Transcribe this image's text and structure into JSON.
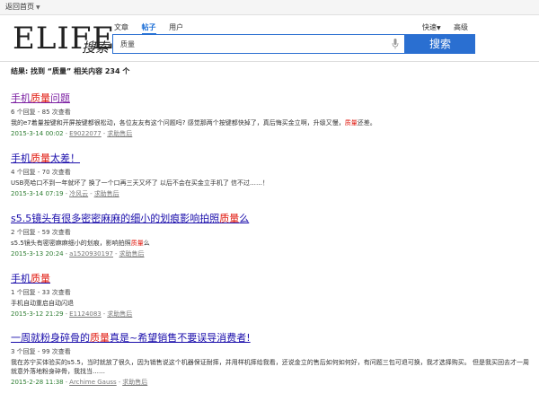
{
  "topbar": {
    "back_label": "返回首页"
  },
  "logo": {
    "main": "ELIFE",
    "sub": "搜索"
  },
  "tabs": [
    {
      "label": "文章",
      "active": false
    },
    {
      "label": "帖子",
      "active": true
    },
    {
      "label": "用户",
      "active": false
    }
  ],
  "right": {
    "fast_label": "快速",
    "advanced_label": "高级"
  },
  "search": {
    "value": "质量",
    "button_label": "搜索"
  },
  "summary": "结果: 找到 “质量” 相关内容 234 个",
  "results": [
    {
      "title_pre": "手机",
      "title_hl": "质量",
      "title_post": "问题",
      "stats": "6 个回复 - 85 次查看",
      "snippet_pre": "我的e7着量按键和开屏按键都很松动，各位友友有这个问题吗? 感觉那两个按键都快掉了，真后悔买金立啊，升级又慢，",
      "snippet_hl": "质量",
      "snippet_post": "还差。",
      "date": "2015-3-14 00:02",
      "user": "E9022077",
      "category": "求助售后"
    },
    {
      "title_pre": "手机",
      "title_hl": "质量",
      "title_post": "太差！",
      "stats": "4 个回复 - 70 次查看",
      "snippet_pre": "USB亮哈口不到一年就坏了 换了一个口再三天又坏了 以后不会在买金立手机了 信不过……！",
      "snippet_hl": "",
      "snippet_post": "",
      "date": "2015-3-14 07:19",
      "user": "冷风云",
      "category": "求助售后"
    },
    {
      "title_pre": "s5.5镜头有很多密密麻麻的细小的划痕影响拍照",
      "title_hl": "质量",
      "title_post": "么",
      "stats": "2 个回复 - 59 次查看",
      "snippet_pre": "s5.5镜头有密密麻麻细小的划痕，影响拍照",
      "snippet_hl": "质量",
      "snippet_post": "么",
      "date": "2015-3-13 20:24",
      "user": "a1520930197",
      "category": "求助售后"
    },
    {
      "title_pre": "手机",
      "title_hl": "质量",
      "title_post": "",
      "stats": "1 个回复 - 33 次查看",
      "snippet_pre": "手机自动重启自动闪退",
      "snippet_hl": "",
      "snippet_post": "",
      "date": "2015-3-12 21:29",
      "user": "E1124083",
      "category": "求助售后"
    },
    {
      "title_pre": "一周就粉身碎骨的",
      "title_hl": "质量",
      "title_post": "真是~希望销售不要误导消费者!",
      "stats": "3 个回复 - 99 次查看",
      "snippet_pre": "我在苏宁买体验买的s5.5，当时就放了很久，因为销售说这个机器保证耐摔，并用样机摔给我看，还说金立的售后如何如何好，有问题三包可退可换，我才选择购买。 但是我买回去才一周就意外落地粉身碎骨，我找当……",
      "snippet_hl": "",
      "snippet_post": "",
      "date": "2015-2-28 11:38",
      "user": "Archime Gauss",
      "category": "求助售后"
    }
  ]
}
